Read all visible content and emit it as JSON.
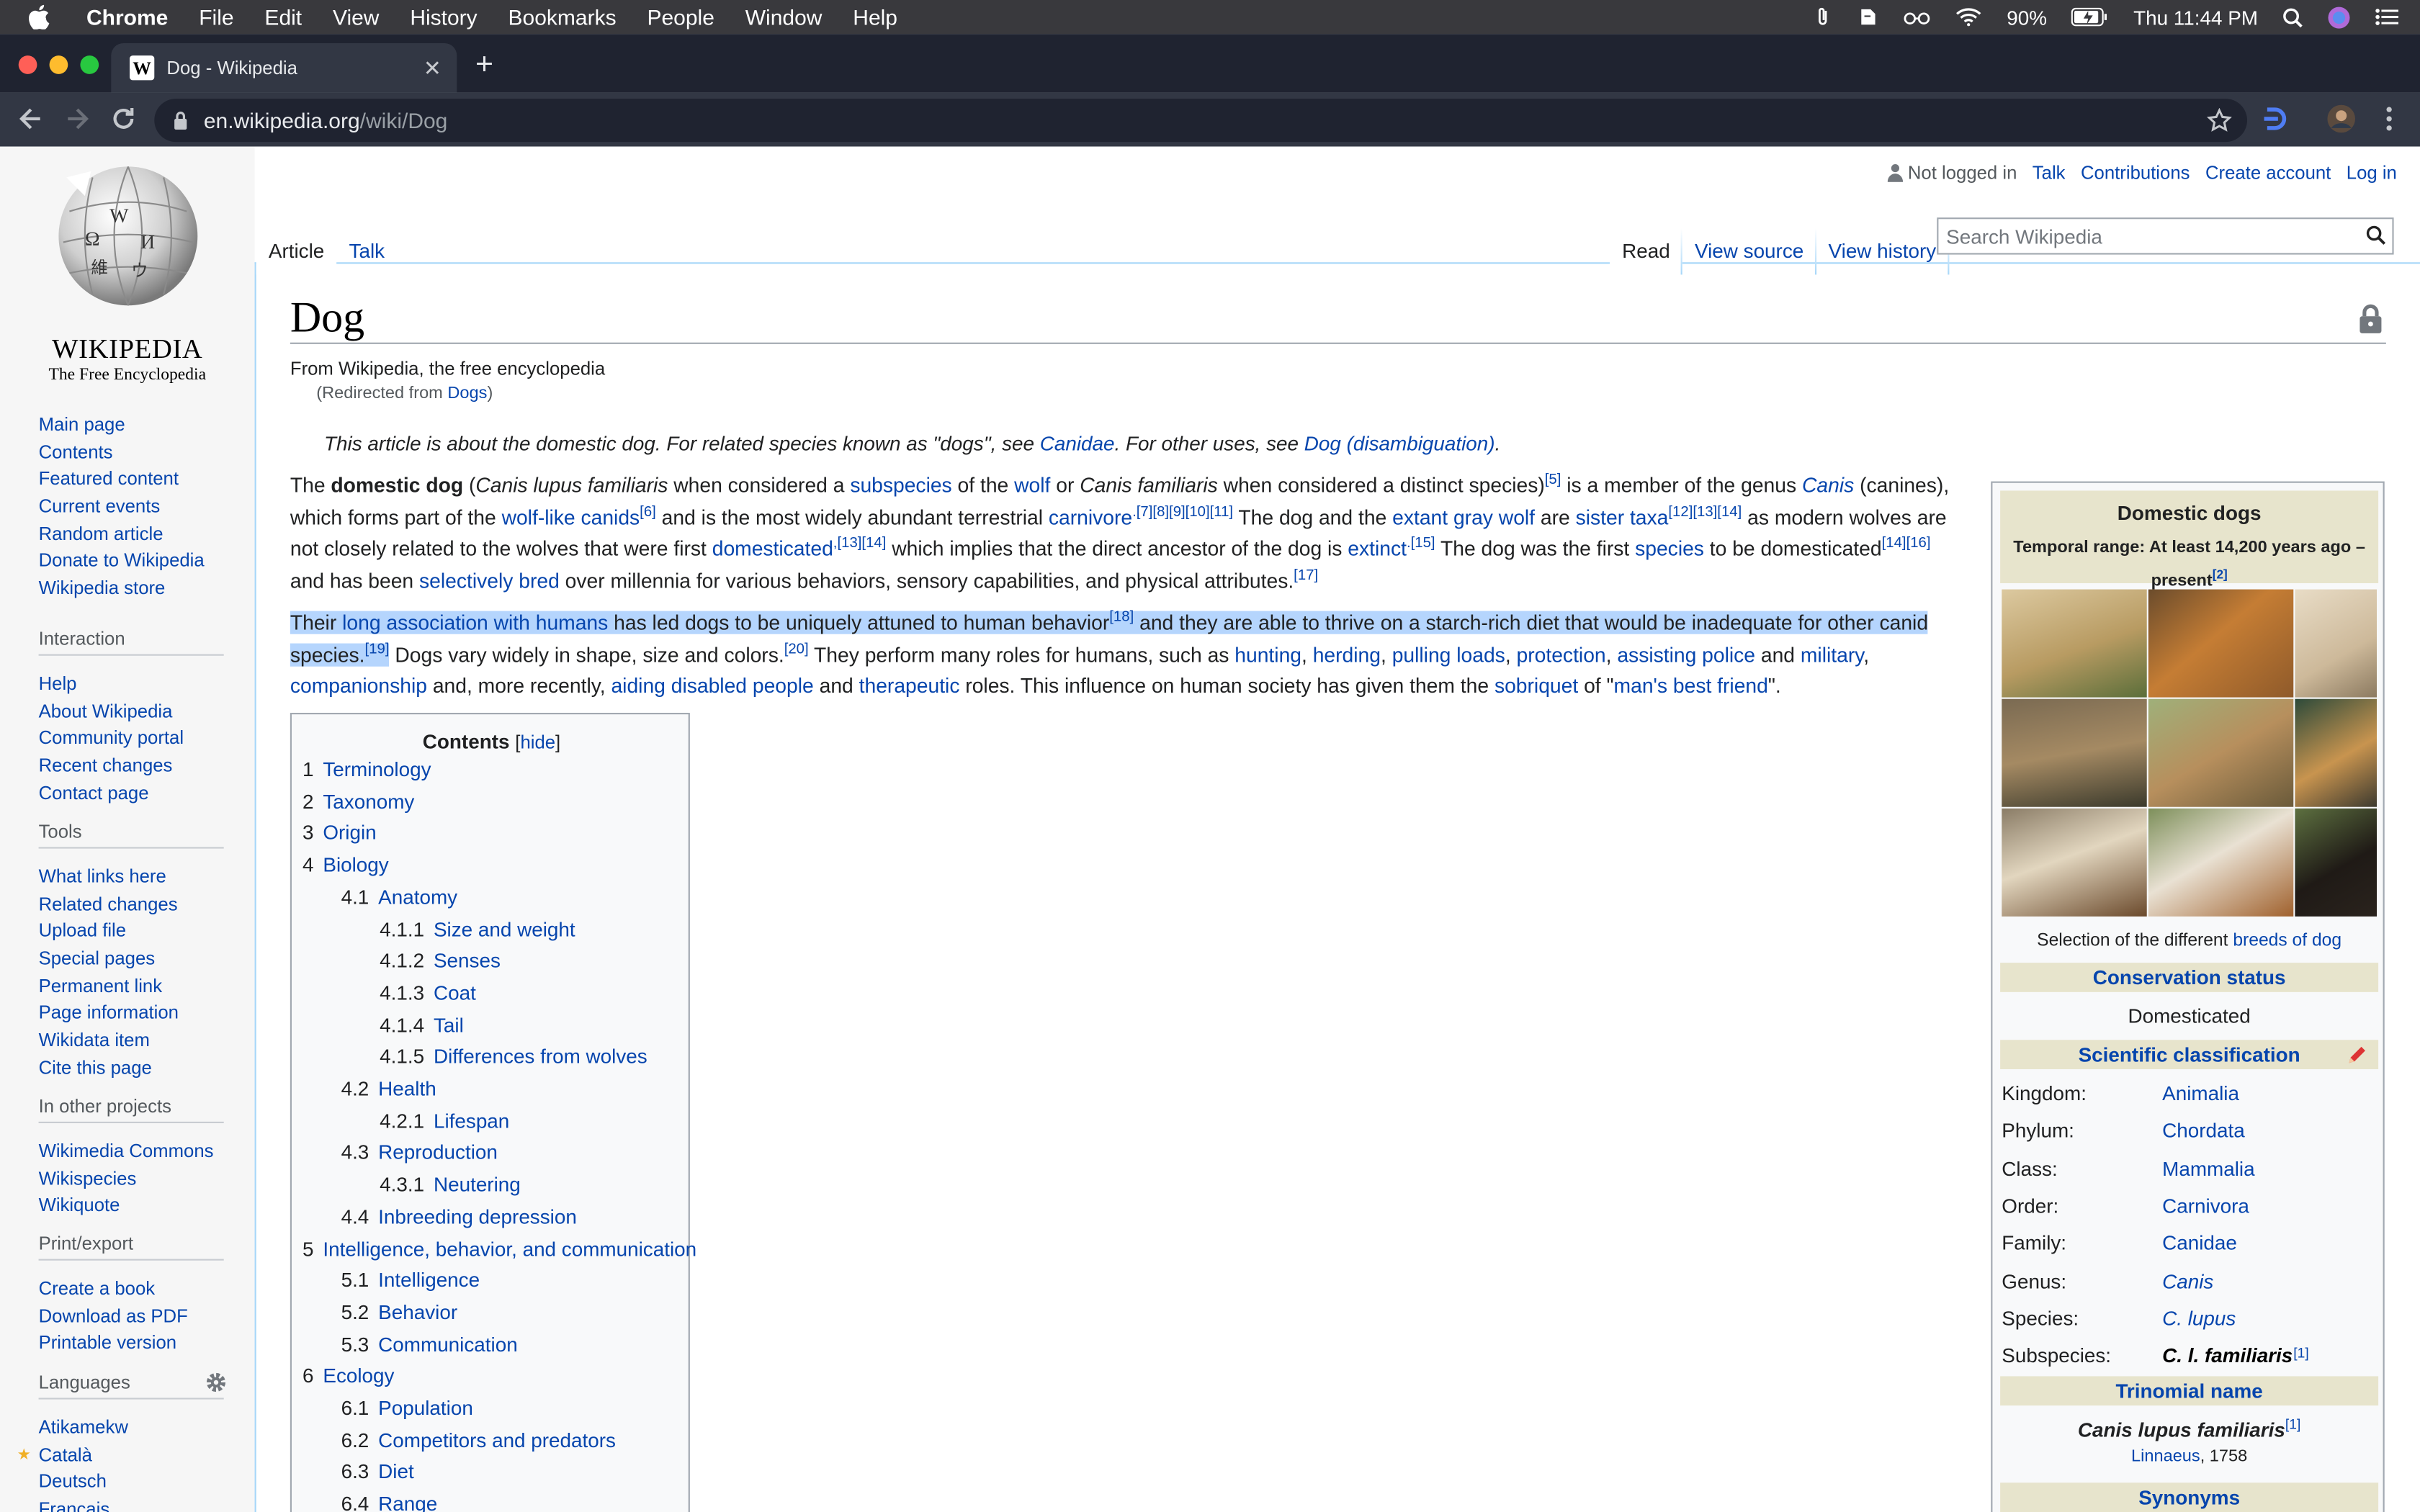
{
  "menubar": {
    "app": "Chrome",
    "items": [
      "File",
      "Edit",
      "View",
      "History",
      "Bookmarks",
      "People",
      "Window",
      "Help"
    ],
    "battery": "90%",
    "clock": "Thu 11:44 PM"
  },
  "browser": {
    "tab_title": "Dog - Wikipedia",
    "url_host": "en.wikipedia.org",
    "url_path": "/wiki/Dog"
  },
  "wiki": {
    "wordmark": "Wikipedia",
    "tagline": "The Free Encyclopedia",
    "nav": [
      "Main page",
      "Contents",
      "Featured content",
      "Current events",
      "Random article",
      "Donate to Wikipedia",
      "Wikipedia store"
    ],
    "interaction": {
      "heading": "Interaction",
      "items": [
        "Help",
        "About Wikipedia",
        "Community portal",
        "Recent changes",
        "Contact page"
      ]
    },
    "tools": {
      "heading": "Tools",
      "items": [
        "What links here",
        "Related changes",
        "Upload file",
        "Special pages",
        "Permanent link",
        "Page information",
        "Wikidata item",
        "Cite this page"
      ]
    },
    "other_projects": {
      "heading": "In other projects",
      "items": [
        "Wikimedia Commons",
        "Wikispecies",
        "Wikiquote"
      ]
    },
    "print": {
      "heading": "Print/export",
      "items": [
        "Create a book",
        "Download as PDF",
        "Printable version"
      ]
    },
    "languages": {
      "heading": "Languages",
      "items": [
        "Atikamekw",
        "Català",
        "Deutsch",
        "Français"
      ]
    },
    "personal": {
      "not_logged": "Not logged in",
      "talk": "Talk",
      "contributions": "Contributions",
      "create_account": "Create account",
      "login": "Log in"
    },
    "tabs": {
      "article": "Article",
      "talk": "Talk",
      "read": "Read",
      "view_source": "View source",
      "view_history": "View history"
    },
    "search_placeholder": "Search Wikipedia"
  },
  "article": {
    "title": "Dog",
    "site_sub": "From Wikipedia, the free encyclopedia",
    "redirect_prefix": "(Redirected from ",
    "redirect_link": "Dogs",
    "redirect_suffix": ")",
    "hatnote": {
      "t1": "This article is about the domestic dog. For related species known as \"dogs\", see ",
      "l1": "Canidae",
      "t2": ". For other uses, see ",
      "l2": "Dog (disambiguation)",
      "t3": "."
    },
    "p1": {
      "s1": "The ",
      "b1": "domestic dog",
      "s2": " (",
      "i1": "Canis lupus familiaris",
      "s3": " when considered a ",
      "l1": "subspecies",
      "s4": " of the ",
      "l2": "wolf",
      "s5": " or ",
      "i2": "Canis familiaris",
      "s6": " when considered a distinct species)",
      "r1": "[5]",
      "s7": " is a member of the genus ",
      "l3": "Canis",
      "s8": " (canines), which forms part of the ",
      "l4": "wolf-like canids",
      "r2": "[6]",
      "s9": " and is the most widely abundant terrestrial ",
      "l5": "carnivore",
      "r3": ".[7][8][9][10][11]",
      "s10": " The dog and the ",
      "l6": "extant gray wolf",
      "s11": " are ",
      "l7": "sister taxa",
      "r4": "[12][13][14]",
      "s12": " as modern wolves are not closely related to the wolves that were first ",
      "l8": "domesticated",
      "r5": ",[13][14]",
      "s13": " which implies that the direct ancestor of the dog is ",
      "l9": "extinct",
      "r6": ".[15]",
      "s14": " The dog was the first ",
      "l10": "species",
      "s15": " to be domesticated",
      "r7": "[14][16]",
      "s16": " and has been ",
      "l11": "selectively bred",
      "s17": " over millennia for various behaviors, sensory capabilities, and physical attributes.",
      "r8": "[17]"
    },
    "p2": {
      "s1": "Their ",
      "l1": "long association with humans",
      "s2": " has led dogs to be uniquely attuned to human behavior",
      "r1": "[18]",
      "s3": " and they are able to thrive on a starch-rich diet that would be inadequate for other canid species.",
      "r2": "[19]",
      "s4": " Dogs vary widely in shape, size and colors.",
      "r3": "[20]",
      "s5": " They perform many roles for humans, such as ",
      "l2": "hunting",
      "s6": ", ",
      "l3": "herding",
      "s7": ", ",
      "l4": "pulling loads",
      "s8": ", ",
      "l5": "protection",
      "s9": ", ",
      "l6": "assisting police",
      "s10": " and ",
      "l7": "military",
      "s11": ", ",
      "l8": "companionship",
      "s12": " and, more recently, ",
      "l9": "aiding disabled people",
      "s13": " and ",
      "l10": "therapeutic",
      "s14": " roles. This influence on human society has given them the ",
      "l11": "sobriquet",
      "s15": " of \"",
      "l12": "man's best friend",
      "s16": "\"."
    }
  },
  "toc": {
    "title": "Contents",
    "hide": "hide",
    "items": [
      {
        "num": "1",
        "text": "Terminology"
      },
      {
        "num": "2",
        "text": "Taxonomy"
      },
      {
        "num": "3",
        "text": "Origin"
      },
      {
        "num": "4",
        "text": "Biology"
      },
      {
        "num": "4.1",
        "text": "Anatomy"
      },
      {
        "num": "4.1.1",
        "text": "Size and weight"
      },
      {
        "num": "4.1.2",
        "text": "Senses"
      },
      {
        "num": "4.1.3",
        "text": "Coat"
      },
      {
        "num": "4.1.4",
        "text": "Tail"
      },
      {
        "num": "4.1.5",
        "text": "Differences from wolves"
      },
      {
        "num": "4.2",
        "text": "Health"
      },
      {
        "num": "4.2.1",
        "text": "Lifespan"
      },
      {
        "num": "4.3",
        "text": "Reproduction"
      },
      {
        "num": "4.3.1",
        "text": "Neutering"
      },
      {
        "num": "4.4",
        "text": "Inbreeding depression"
      },
      {
        "num": "5",
        "text": "Intelligence, behavior, and communication"
      },
      {
        "num": "5.1",
        "text": "Intelligence"
      },
      {
        "num": "5.2",
        "text": "Behavior"
      },
      {
        "num": "5.3",
        "text": "Communication"
      },
      {
        "num": "6",
        "text": "Ecology"
      },
      {
        "num": "6.1",
        "text": "Population"
      },
      {
        "num": "6.2",
        "text": "Competitors and predators"
      },
      {
        "num": "6.3",
        "text": "Diet"
      },
      {
        "num": "6.4",
        "text": "Range"
      }
    ]
  },
  "infobox": {
    "title": "Domestic dogs",
    "range": "Temporal range: At least 14,200 years ago – present",
    "range_ref": "[2]",
    "caption_text": "Selection of the different ",
    "caption_link": "breeds of dog",
    "conservation_heading": "Conservation status",
    "conservation_value": "Domesticated",
    "classification_heading": "Scientific classification",
    "rows": [
      {
        "k": "Kingdom:",
        "v": "Animalia"
      },
      {
        "k": "Phylum:",
        "v": "Chordata"
      },
      {
        "k": "Class:",
        "v": "Mammalia"
      },
      {
        "k": "Order:",
        "v": "Carnivora"
      },
      {
        "k": "Family:",
        "v": "Canidae"
      },
      {
        "k": "Genus:",
        "v": "Canis"
      },
      {
        "k": "Species:",
        "v": "C. lupus"
      },
      {
        "k": "Subspecies:",
        "v": "C. l. familiaris"
      }
    ],
    "subspecies_ref": "[1]",
    "trinomial_heading": "Trinomial name",
    "trinomial": "Canis lupus familiaris",
    "trinomial_ref": "[1]",
    "authority_link": "Linnaeus",
    "authority_year": ", 1758",
    "synonyms_heading": "Synonyms"
  }
}
